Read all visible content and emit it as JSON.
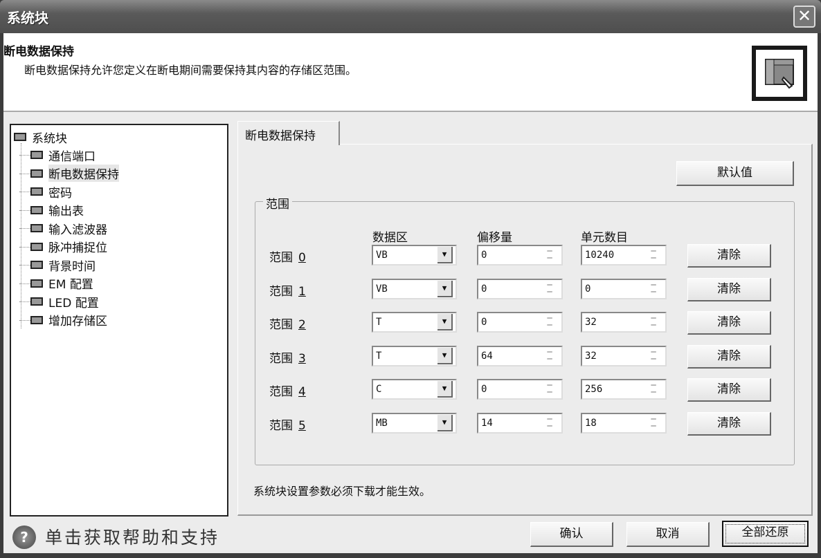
{
  "window": {
    "title": "系统块",
    "close": "✕"
  },
  "header": {
    "title": "断电数据保持",
    "description": "断电数据保持允许您定义在断电期间需要保持其内容的存储区范围。"
  },
  "tree": {
    "root": "系统块",
    "items": [
      "通信端口",
      "断电数据保持",
      "密码",
      "输出表",
      "输入滤波器",
      "脉冲捕捉位",
      "背景时间",
      "EM 配置",
      "LED 配置",
      "增加存储区"
    ]
  },
  "tab": "断电数据保持",
  "default_button": "默认值",
  "group": {
    "label": "范围",
    "columns": [
      "数据区",
      "偏移量",
      "单元数目"
    ],
    "rows": [
      {
        "label": "范围",
        "index": "0",
        "area": "VB",
        "offset": "0",
        "count": "10240",
        "clear": "清除"
      },
      {
        "label": "范围",
        "index": "1",
        "area": "VB",
        "offset": "0",
        "count": "0",
        "clear": "清除"
      },
      {
        "label": "范围",
        "index": "2",
        "area": "T",
        "offset": "0",
        "count": "32",
        "clear": "清除"
      },
      {
        "label": "范围",
        "index": "3",
        "area": "T",
        "offset": "64",
        "count": "32",
        "clear": "清除"
      },
      {
        "label": "范围",
        "index": "4",
        "area": "C",
        "offset": "0",
        "count": "256",
        "clear": "清除"
      },
      {
        "label": "范围",
        "index": "5",
        "area": "MB",
        "offset": "14",
        "count": "18",
        "clear": "清除"
      }
    ]
  },
  "note": "系统块设置参数必须下载才能生效。",
  "footer": {
    "help_icon": "?",
    "help": "单击获取帮助和支持",
    "ok": "确认",
    "cancel": "取消",
    "restore": "全部还原"
  }
}
